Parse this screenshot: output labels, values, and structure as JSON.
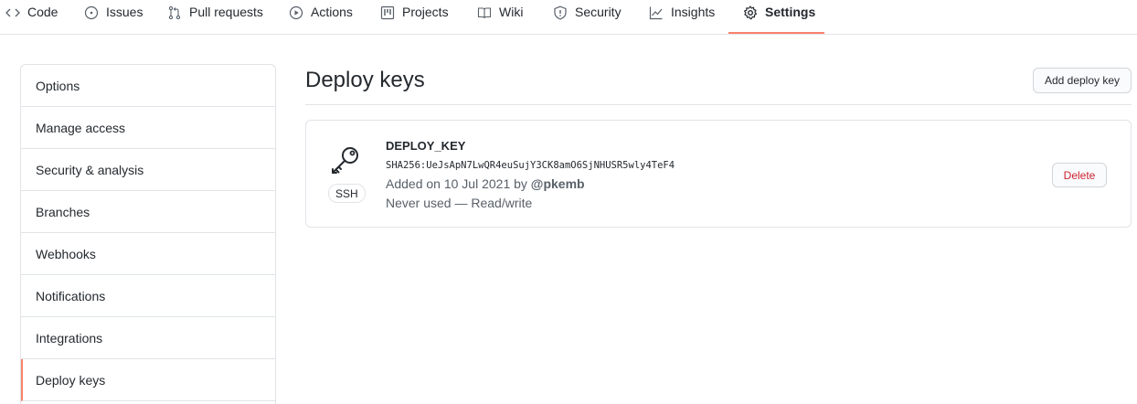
{
  "nav": {
    "tabs": [
      {
        "label": "Code",
        "icon": "code-icon"
      },
      {
        "label": "Issues",
        "icon": "issue-opened-icon"
      },
      {
        "label": "Pull requests",
        "icon": "git-pull-request-icon"
      },
      {
        "label": "Actions",
        "icon": "play-icon"
      },
      {
        "label": "Projects",
        "icon": "project-icon"
      },
      {
        "label": "Wiki",
        "icon": "book-icon"
      },
      {
        "label": "Security",
        "icon": "shield-icon"
      },
      {
        "label": "Insights",
        "icon": "graph-icon"
      },
      {
        "label": "Settings",
        "icon": "gear-icon"
      }
    ],
    "selected": "Settings",
    "underline_color": "#f9826c"
  },
  "sidebar": {
    "items": [
      {
        "label": "Options"
      },
      {
        "label": "Manage access"
      },
      {
        "label": "Security & analysis"
      },
      {
        "label": "Branches"
      },
      {
        "label": "Webhooks"
      },
      {
        "label": "Notifications"
      },
      {
        "label": "Integrations"
      },
      {
        "label": "Deploy keys"
      }
    ],
    "active": "Deploy keys"
  },
  "main": {
    "title": "Deploy keys",
    "add_button": "Add deploy key",
    "key": {
      "badge": "SSH",
      "name": "DEPLOY_KEY",
      "fingerprint": "SHA256:UeJsApN7LwQR4euSujY3CK8amO6SjNHUSR5wly4TeF4",
      "added_prefix": "Added on 10 Jul 2021 by",
      "added_by": "@pkemb",
      "usage": "Never used — Read/write",
      "delete_button": "Delete"
    }
  },
  "colors": {
    "accent": "#f9826c",
    "danger": "#cb2431",
    "border": "#e1e4e8",
    "muted_text": "#586069"
  }
}
